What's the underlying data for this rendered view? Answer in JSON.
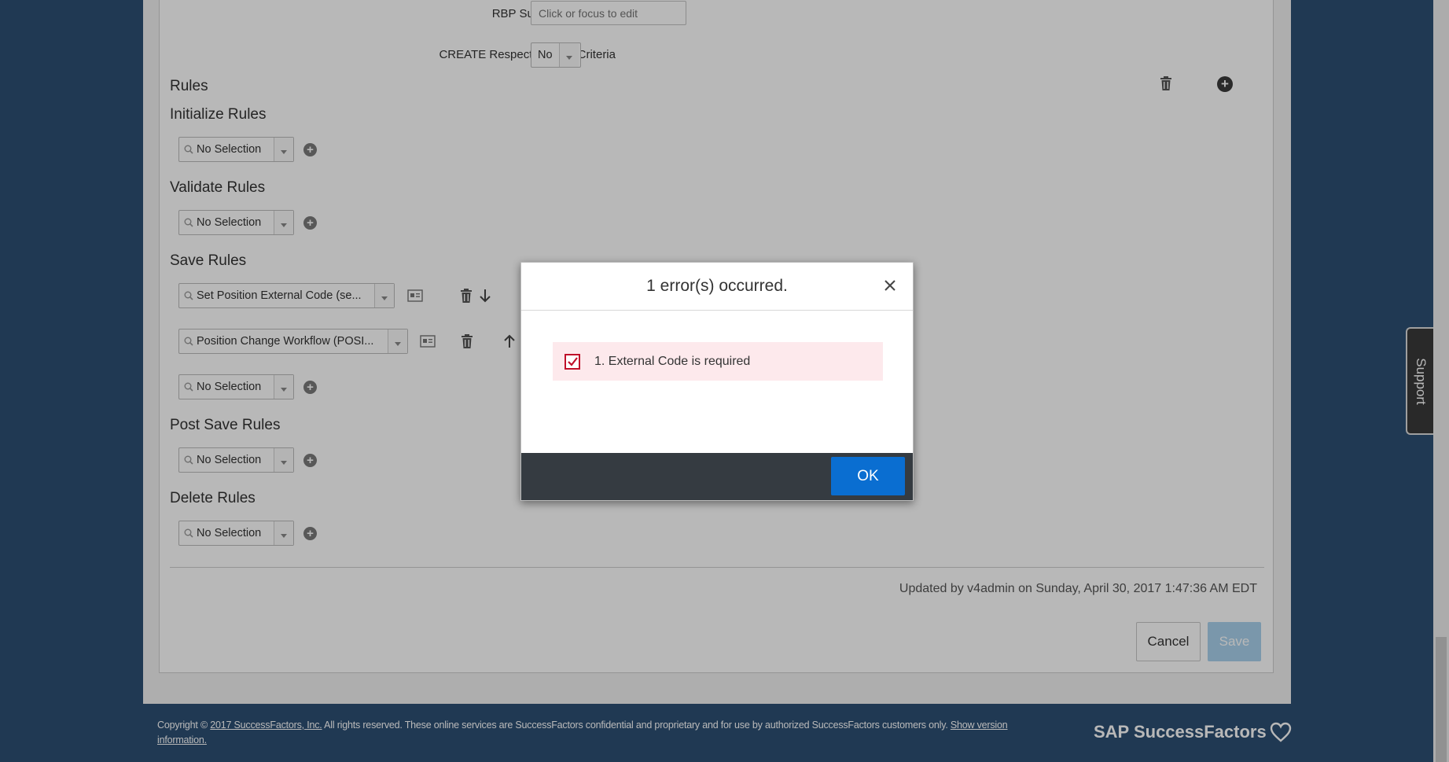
{
  "form": {
    "rbp_label": "RBP Subject User Field",
    "rbp_placeholder": "Click or focus to edit",
    "create_label": "CREATE Respects Target Criteria",
    "create_value": "No"
  },
  "rules": {
    "title": "Rules",
    "initialize": {
      "title": "Initialize Rules",
      "value": "No Selection"
    },
    "validate": {
      "title": "Validate Rules",
      "value": "No Selection"
    },
    "save": {
      "title": "Save Rules",
      "items": [
        {
          "value": "Set Position External Code (se..."
        },
        {
          "value": "Position Change Workflow (POSI..."
        },
        {
          "value": "No Selection"
        }
      ]
    },
    "post_save": {
      "title": "Post Save Rules",
      "value": "No Selection"
    },
    "delete": {
      "title": "Delete Rules",
      "value": "No Selection"
    }
  },
  "status": {
    "updated": "Updated by v4admin on Sunday, April 30, 2017 1:47:36 AM EDT"
  },
  "actions": {
    "cancel": "Cancel",
    "save": "Save"
  },
  "support": {
    "label": "Support"
  },
  "footer": {
    "copyright_prefix": "Copyright ©",
    "copyright_link": "2017 SuccessFactors, Inc.",
    "copyright_body": " All rights reserved. These online services are SuccessFactors confidential and proprietary and for use by authorized SuccessFactors customers only. ",
    "version_link": "Show version information.",
    "logo": "SAP SuccessFactors"
  },
  "dialog": {
    "title": "1 error(s) occurred.",
    "error": "1. External Code is required",
    "ok": "OK"
  },
  "colors": {
    "background": "#2d4f73",
    "primary_button": "#0a6ed1",
    "error_bg": "#fde9ec",
    "error_icon": "#c0102a"
  },
  "icons": [
    "search-icon",
    "trash-icon",
    "add-icon",
    "arrow-down-icon",
    "arrow-up-icon",
    "details-icon",
    "close-icon",
    "checkbox-icon",
    "heart-icon"
  ]
}
